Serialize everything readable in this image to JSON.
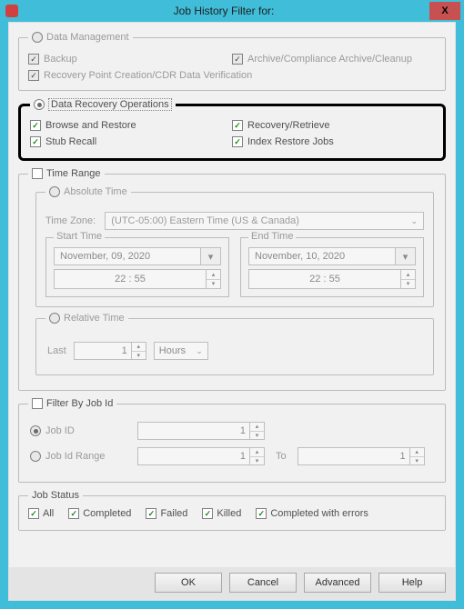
{
  "window": {
    "title": "Job History Filter for:",
    "close": "X"
  },
  "groups": {
    "data_mgmt": {
      "legend": "Data Management",
      "backup": "Backup",
      "archive": "Archive/Compliance Archive/Cleanup",
      "rp": "Recovery Point Creation/CDR Data Verification"
    },
    "dro": {
      "legend": "Data Recovery Operations",
      "browse": "Browse and Restore",
      "recovery": "Recovery/Retrieve",
      "stub": "Stub Recall",
      "index": "Index Restore Jobs"
    },
    "time_range": {
      "legend": "Time Range",
      "absolute": "Absolute Time",
      "tz_label": "Time Zone:",
      "tz_value": "(UTC-05:00) Eastern Time (US & Canada)",
      "start_legend": "Start Time",
      "end_legend": "End Time",
      "start_date": "November, 09, 2020",
      "end_date": "November, 10, 2020",
      "start_time": "22 : 55",
      "end_time": "22 : 55",
      "relative": "Relative Time",
      "last_label": "Last",
      "last_value": "1",
      "last_unit": "Hours"
    },
    "filter_job": {
      "legend": "Filter By Job Id",
      "job_id": "Job ID",
      "job_id_range": "Job Id Range",
      "val1": "1",
      "to": "To",
      "val2": "1"
    },
    "status": {
      "legend": "Job Status",
      "all": "All",
      "completed": "Completed",
      "failed": "Failed",
      "killed": "Killed",
      "cwe": "Completed with errors"
    }
  },
  "buttons": {
    "ok": "OK",
    "cancel": "Cancel",
    "advanced": "Advanced",
    "help": "Help"
  }
}
